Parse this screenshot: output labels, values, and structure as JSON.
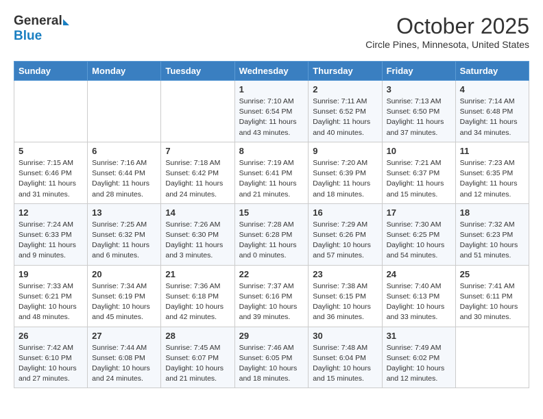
{
  "header": {
    "logo_general": "General",
    "logo_blue": "Blue",
    "month_title": "October 2025",
    "location": "Circle Pines, Minnesota, United States"
  },
  "weekdays": [
    "Sunday",
    "Monday",
    "Tuesday",
    "Wednesday",
    "Thursday",
    "Friday",
    "Saturday"
  ],
  "weeks": [
    [
      {
        "day": "",
        "info": ""
      },
      {
        "day": "",
        "info": ""
      },
      {
        "day": "",
        "info": ""
      },
      {
        "day": "1",
        "info": "Sunrise: 7:10 AM\nSunset: 6:54 PM\nDaylight: 11 hours\nand 43 minutes."
      },
      {
        "day": "2",
        "info": "Sunrise: 7:11 AM\nSunset: 6:52 PM\nDaylight: 11 hours\nand 40 minutes."
      },
      {
        "day": "3",
        "info": "Sunrise: 7:13 AM\nSunset: 6:50 PM\nDaylight: 11 hours\nand 37 minutes."
      },
      {
        "day": "4",
        "info": "Sunrise: 7:14 AM\nSunset: 6:48 PM\nDaylight: 11 hours\nand 34 minutes."
      }
    ],
    [
      {
        "day": "5",
        "info": "Sunrise: 7:15 AM\nSunset: 6:46 PM\nDaylight: 11 hours\nand 31 minutes."
      },
      {
        "day": "6",
        "info": "Sunrise: 7:16 AM\nSunset: 6:44 PM\nDaylight: 11 hours\nand 28 minutes."
      },
      {
        "day": "7",
        "info": "Sunrise: 7:18 AM\nSunset: 6:42 PM\nDaylight: 11 hours\nand 24 minutes."
      },
      {
        "day": "8",
        "info": "Sunrise: 7:19 AM\nSunset: 6:41 PM\nDaylight: 11 hours\nand 21 minutes."
      },
      {
        "day": "9",
        "info": "Sunrise: 7:20 AM\nSunset: 6:39 PM\nDaylight: 11 hours\nand 18 minutes."
      },
      {
        "day": "10",
        "info": "Sunrise: 7:21 AM\nSunset: 6:37 PM\nDaylight: 11 hours\nand 15 minutes."
      },
      {
        "day": "11",
        "info": "Sunrise: 7:23 AM\nSunset: 6:35 PM\nDaylight: 11 hours\nand 12 minutes."
      }
    ],
    [
      {
        "day": "12",
        "info": "Sunrise: 7:24 AM\nSunset: 6:33 PM\nDaylight: 11 hours\nand 9 minutes."
      },
      {
        "day": "13",
        "info": "Sunrise: 7:25 AM\nSunset: 6:32 PM\nDaylight: 11 hours\nand 6 minutes."
      },
      {
        "day": "14",
        "info": "Sunrise: 7:26 AM\nSunset: 6:30 PM\nDaylight: 11 hours\nand 3 minutes."
      },
      {
        "day": "15",
        "info": "Sunrise: 7:28 AM\nSunset: 6:28 PM\nDaylight: 11 hours\nand 0 minutes."
      },
      {
        "day": "16",
        "info": "Sunrise: 7:29 AM\nSunset: 6:26 PM\nDaylight: 10 hours\nand 57 minutes."
      },
      {
        "day": "17",
        "info": "Sunrise: 7:30 AM\nSunset: 6:25 PM\nDaylight: 10 hours\nand 54 minutes."
      },
      {
        "day": "18",
        "info": "Sunrise: 7:32 AM\nSunset: 6:23 PM\nDaylight: 10 hours\nand 51 minutes."
      }
    ],
    [
      {
        "day": "19",
        "info": "Sunrise: 7:33 AM\nSunset: 6:21 PM\nDaylight: 10 hours\nand 48 minutes."
      },
      {
        "day": "20",
        "info": "Sunrise: 7:34 AM\nSunset: 6:19 PM\nDaylight: 10 hours\nand 45 minutes."
      },
      {
        "day": "21",
        "info": "Sunrise: 7:36 AM\nSunset: 6:18 PM\nDaylight: 10 hours\nand 42 minutes."
      },
      {
        "day": "22",
        "info": "Sunrise: 7:37 AM\nSunset: 6:16 PM\nDaylight: 10 hours\nand 39 minutes."
      },
      {
        "day": "23",
        "info": "Sunrise: 7:38 AM\nSunset: 6:15 PM\nDaylight: 10 hours\nand 36 minutes."
      },
      {
        "day": "24",
        "info": "Sunrise: 7:40 AM\nSunset: 6:13 PM\nDaylight: 10 hours\nand 33 minutes."
      },
      {
        "day": "25",
        "info": "Sunrise: 7:41 AM\nSunset: 6:11 PM\nDaylight: 10 hours\nand 30 minutes."
      }
    ],
    [
      {
        "day": "26",
        "info": "Sunrise: 7:42 AM\nSunset: 6:10 PM\nDaylight: 10 hours\nand 27 minutes."
      },
      {
        "day": "27",
        "info": "Sunrise: 7:44 AM\nSunset: 6:08 PM\nDaylight: 10 hours\nand 24 minutes."
      },
      {
        "day": "28",
        "info": "Sunrise: 7:45 AM\nSunset: 6:07 PM\nDaylight: 10 hours\nand 21 minutes."
      },
      {
        "day": "29",
        "info": "Sunrise: 7:46 AM\nSunset: 6:05 PM\nDaylight: 10 hours\nand 18 minutes."
      },
      {
        "day": "30",
        "info": "Sunrise: 7:48 AM\nSunset: 6:04 PM\nDaylight: 10 hours\nand 15 minutes."
      },
      {
        "day": "31",
        "info": "Sunrise: 7:49 AM\nSunset: 6:02 PM\nDaylight: 10 hours\nand 12 minutes."
      },
      {
        "day": "",
        "info": ""
      }
    ]
  ]
}
